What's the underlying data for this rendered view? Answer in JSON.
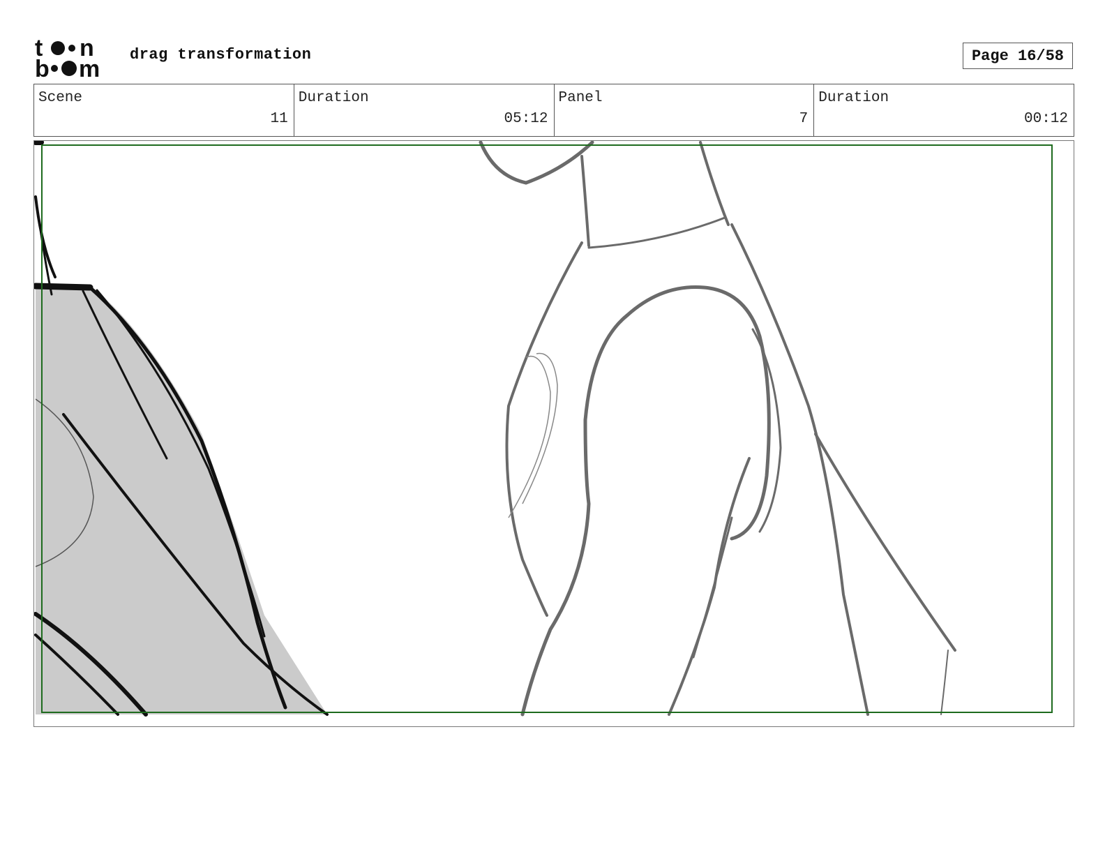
{
  "header": {
    "logo": {
      "lines": [
        "toon",
        "boom"
      ]
    },
    "title": "drag transformation",
    "page": "Page 16/58"
  },
  "info": {
    "scene_label": "Scene",
    "scene_value": "11",
    "scene_duration_label": "Duration",
    "scene_duration_value": "05:12",
    "panel_label": "Panel",
    "panel_value": "7",
    "panel_duration_label": "Duration",
    "panel_duration_value": "00:12"
  },
  "colors": {
    "safe_frame": "#1e6b1e",
    "sketch_dark": "#111111",
    "sketch_gray": "#6a6a6a",
    "fill_gray": "#cbcbcb"
  }
}
